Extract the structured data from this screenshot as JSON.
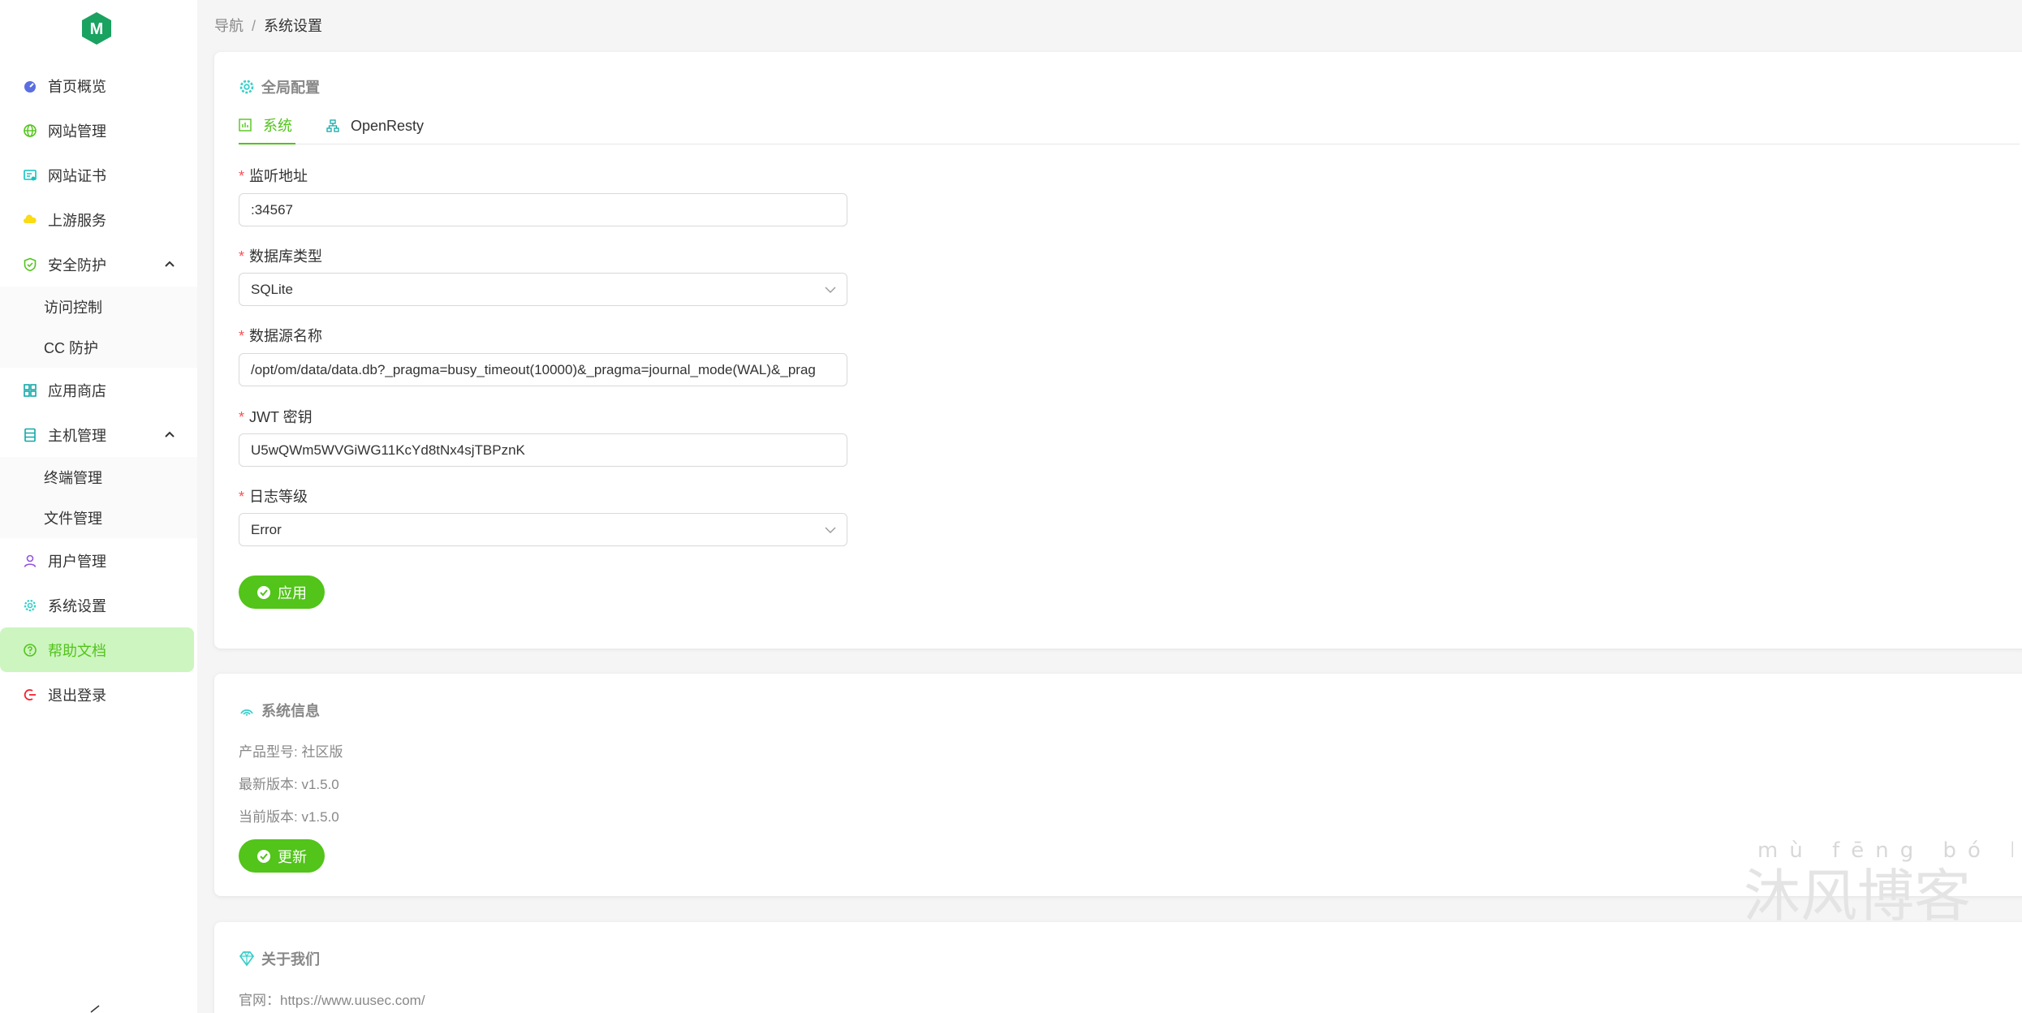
{
  "sidebar": {
    "items": [
      {
        "label": "首页概览",
        "icon": "dashboard-icon"
      },
      {
        "label": "网站管理",
        "icon": "globe-icon"
      },
      {
        "label": "网站证书",
        "icon": "certificate-icon"
      },
      {
        "label": "上游服务",
        "icon": "cloud-icon"
      },
      {
        "label": "安全防护",
        "icon": "shield-icon"
      },
      {
        "label": "应用商店",
        "icon": "apps-icon"
      },
      {
        "label": "主机管理",
        "icon": "server-icon"
      },
      {
        "label": "用户管理",
        "icon": "user-icon"
      },
      {
        "label": "系统设置",
        "icon": "gear-icon"
      },
      {
        "label": "帮助文档",
        "icon": "help-icon"
      },
      {
        "label": "退出登录",
        "icon": "logout-icon"
      }
    ],
    "security_sub": [
      "访问控制",
      "CC 防护"
    ],
    "host_sub": [
      "终端管理",
      "文件管理"
    ]
  },
  "breadcrumb": {
    "root": "导航",
    "sep": "/",
    "current": "系统设置"
  },
  "global_config": {
    "title": "全局配置",
    "tabs": [
      {
        "label": "系统"
      },
      {
        "label": "OpenResty"
      }
    ],
    "fields": {
      "listen": {
        "label": "监听地址",
        "value": ":34567"
      },
      "db_type": {
        "label": "数据库类型",
        "value": "SQLite"
      },
      "dsn": {
        "label": "数据源名称",
        "value": "/opt/om/data/data.db?_pragma=busy_timeout(10000)&_pragma=journal_mode(WAL)&_prag"
      },
      "jwt": {
        "label": "JWT 密钥",
        "value": "U5wQWm5WVGiWG11KcYd8tNx4sjTBPznK"
      },
      "log_level": {
        "label": "日志等级",
        "value": "Error"
      }
    },
    "apply_label": "应用"
  },
  "system_info": {
    "title": "系统信息",
    "model": "产品型号: 社区版",
    "latest": "最新版本: v1.5.0",
    "current": "当前版本: v1.5.0",
    "update_label": "更新"
  },
  "about": {
    "title": "关于我们",
    "website": "官网：https://www.uusec.com/"
  },
  "watermark": {
    "pinyin": "mù fēng bó kè",
    "text": "沐风博客"
  },
  "colors": {
    "accent": "#52c41a",
    "active_bg": "#cdf5c0",
    "required": "#ff4d4f"
  }
}
